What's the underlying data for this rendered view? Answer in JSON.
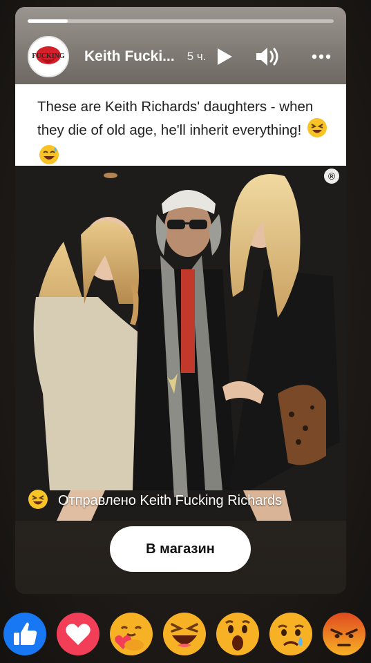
{
  "story": {
    "progress": 0.13,
    "author": "Keith Fucki...",
    "time": "5 ч.",
    "avatar_logo_text": "FUCKING"
  },
  "post": {
    "text": "These are Keith Richards' daughters - when they die of old age, he'll inherit everything!",
    "photo_badge": "®"
  },
  "footer": {
    "sent_by": "Отправлено Keith Fucking Richards",
    "shop_button": "В магазин"
  },
  "reactions": [
    "like-icon",
    "love-icon",
    "care-icon",
    "haha-icon",
    "wow-icon",
    "sad-icon",
    "angry-icon"
  ],
  "colors": {
    "like": "#1877f2",
    "love": "#f33e58",
    "emoji_yellow": "#f7b125",
    "angry": "#e9710f"
  }
}
